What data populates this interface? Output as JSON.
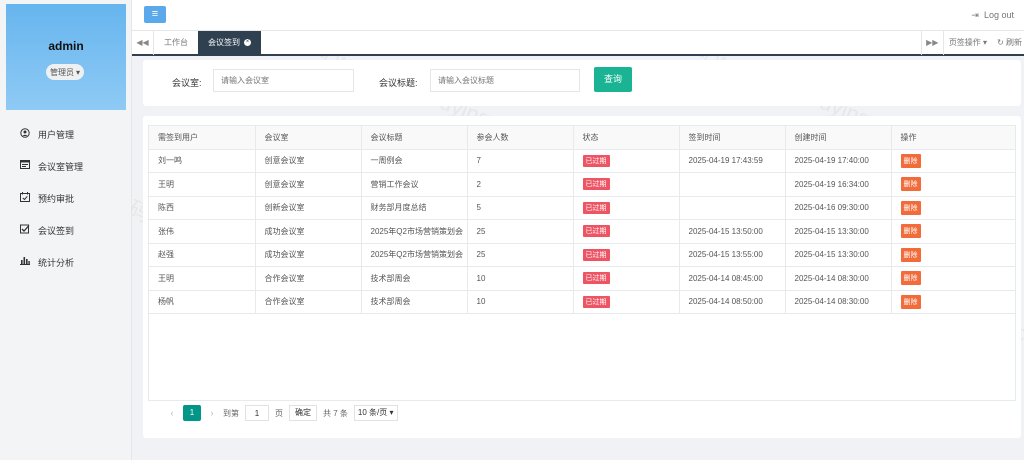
{
  "sidebar": {
    "user_name": "admin",
    "role": "管理员",
    "items": [
      {
        "label": "用户管理",
        "icon": "user-icon"
      },
      {
        "label": "会议室管理",
        "icon": "id-card-icon"
      },
      {
        "label": "预约审批",
        "icon": "calendar-check-icon"
      },
      {
        "label": "会议签到",
        "icon": "checkbox-icon"
      },
      {
        "label": "统计分析",
        "icon": "bar-chart-icon"
      }
    ]
  },
  "topbar": {
    "logout_label": "Log out"
  },
  "tabs": {
    "home": "工作台",
    "active": "会议签到",
    "ops": "页签操作",
    "refresh": "刷新"
  },
  "search": {
    "room_label": "会议室:",
    "room_placeholder": "请输入会议室",
    "title_label": "会议标题:",
    "title_placeholder": "请输入会议标题",
    "query_label": "查询"
  },
  "table": {
    "columns": [
      "需签到用户",
      "会议室",
      "会议标题",
      "参会人数",
      "状态",
      "签到时间",
      "创建时间",
      "操作"
    ],
    "rows": [
      {
        "user": "刘一鸣",
        "room": "创意会议室",
        "title": "一周例会",
        "count": "7",
        "status": "已过期",
        "signin": "2025-04-19 17:43:59",
        "created": "2025-04-19 17:40:00",
        "action": "删除"
      },
      {
        "user": "王明",
        "room": "创意会议室",
        "title": "营销工作会议",
        "count": "2",
        "status": "已过期",
        "signin": "",
        "created": "2025-04-19 16:34:00",
        "action": "删除"
      },
      {
        "user": "陈西",
        "room": "创新会议室",
        "title": "财务部月度总结",
        "count": "5",
        "status": "已过期",
        "signin": "",
        "created": "2025-04-16 09:30:00",
        "action": "删除"
      },
      {
        "user": "张伟",
        "room": "成功会议室",
        "title": "2025年Q2市场营销策划会",
        "count": "25",
        "status": "已过期",
        "signin": "2025-04-15 13:50:00",
        "created": "2025-04-15 13:30:00",
        "action": "删除"
      },
      {
        "user": "赵强",
        "room": "成功会议室",
        "title": "2025年Q2市场营销策划会",
        "count": "25",
        "status": "已过期",
        "signin": "2025-04-15 13:55:00",
        "created": "2025-04-15 13:30:00",
        "action": "删除"
      },
      {
        "user": "王明",
        "room": "合作会议室",
        "title": "技术部周会",
        "count": "10",
        "status": "已过期",
        "signin": "2025-04-14 08:45:00",
        "created": "2025-04-14 08:30:00",
        "action": "删除"
      },
      {
        "user": "杨帆",
        "room": "合作会议室",
        "title": "技术部周会",
        "count": "10",
        "status": "已过期",
        "signin": "2025-04-14 08:50:00",
        "created": "2025-04-14 08:30:00",
        "action": "删除"
      }
    ]
  },
  "pager": {
    "current": "1",
    "goto_label": "到第",
    "goto_value": "1",
    "page_unit": "页",
    "confirm": "确定",
    "total": "共 7 条",
    "page_size": "10 条/页"
  },
  "watermark": "©猫头鹰源码 www.maotouyingcc.com",
  "colors": {
    "accent": "#1ab394",
    "tab_active": "#2f4050",
    "badge": "#ed5565",
    "delete": "#f26b3a",
    "menu_button": "#5ba9ea",
    "profile": "#66b5ee"
  }
}
